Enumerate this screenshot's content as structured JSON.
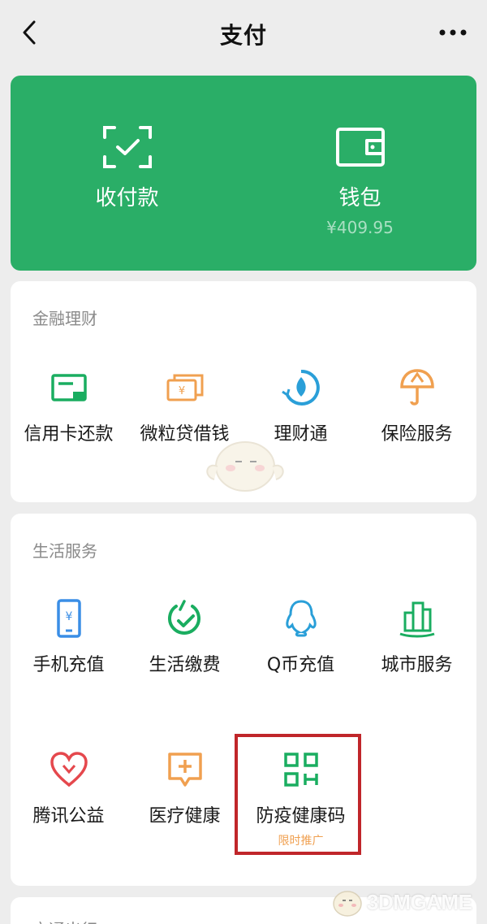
{
  "navbar": {
    "title": "支付"
  },
  "green_card": {
    "receive_pay_label": "收付款",
    "wallet_label": "钱包",
    "wallet_balance": "¥409.95"
  },
  "finance": {
    "title": "金融理财",
    "items": [
      {
        "label": "信用卡还款",
        "icon": "credit-card-icon",
        "color": "#1aad60"
      },
      {
        "label": "微粒贷借钱",
        "icon": "money-stack-icon",
        "color": "#f0a050"
      },
      {
        "label": "理财通",
        "icon": "licaitong-icon",
        "color": "#2a9fd8"
      },
      {
        "label": "保险服务",
        "icon": "insurance-umbrella-icon",
        "color": "#f0a050"
      }
    ]
  },
  "life": {
    "title": "生活服务",
    "items": [
      {
        "label": "手机充值",
        "icon": "phone-recharge-icon",
        "color": "#3a8ee6"
      },
      {
        "label": "生活缴费",
        "icon": "utility-payment-icon",
        "color": "#1aad60"
      },
      {
        "label": "Q币充值",
        "icon": "qq-penguin-icon",
        "color": "#2a9fd8"
      },
      {
        "label": "城市服务",
        "icon": "city-buildings-icon",
        "color": "#1aad60"
      },
      {
        "label": "腾讯公益",
        "icon": "charity-heart-icon",
        "color": "#e5484d"
      },
      {
        "label": "医疗健康",
        "icon": "medical-cross-icon",
        "color": "#f0a050"
      },
      {
        "label": "防疫健康码",
        "icon": "health-code-icon",
        "color": "#1aad60",
        "tag": "限时推广"
      }
    ]
  },
  "transport": {
    "title": "交通出行"
  },
  "watermark": {
    "text": "3DMGAME"
  },
  "colors": {
    "brand_green": "#2aae67",
    "highlight_red": "#c0262a",
    "background": "#ededed"
  }
}
